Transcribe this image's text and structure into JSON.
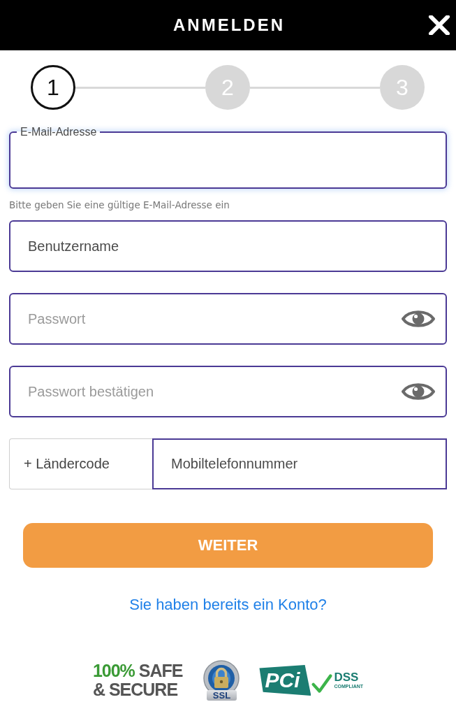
{
  "header": {
    "title": "ANMELDEN"
  },
  "steps": [
    {
      "number": "1",
      "current": true
    },
    {
      "number": "2",
      "current": false
    },
    {
      "number": "3",
      "current": false
    }
  ],
  "fields": [
    {
      "kind": "email",
      "label": "E-Mail-Adresse",
      "focused": true,
      "helper": "Bitte geben Sie eine gültige E-Mail-Adresse ein"
    },
    {
      "kind": "text",
      "placeholder": "Benutzername",
      "focused": false
    },
    {
      "kind": "password",
      "placeholder": "Passwort",
      "focused": false
    },
    {
      "kind": "password",
      "placeholder": "Passwort bestätigen",
      "focused": false
    }
  ],
  "phone": {
    "country_code": "+ Ländercode",
    "placeholder": "Mobiltelefonnummer"
  },
  "submit_button": {
    "label": "WEITER"
  },
  "login_link": {
    "text": "Sie haben bereits ein Konto?"
  },
  "trust_badges": [
    {
      "kind": "safe_secure",
      "highlight": "100%",
      "text": "SAFE",
      "line_2": "& SECURE"
    },
    {
      "kind": "ssl",
      "label": "SSL"
    },
    {
      "kind": "pci",
      "logo": "PCi",
      "text": "DSS",
      "subtext": "COMPLIANT"
    }
  ]
}
